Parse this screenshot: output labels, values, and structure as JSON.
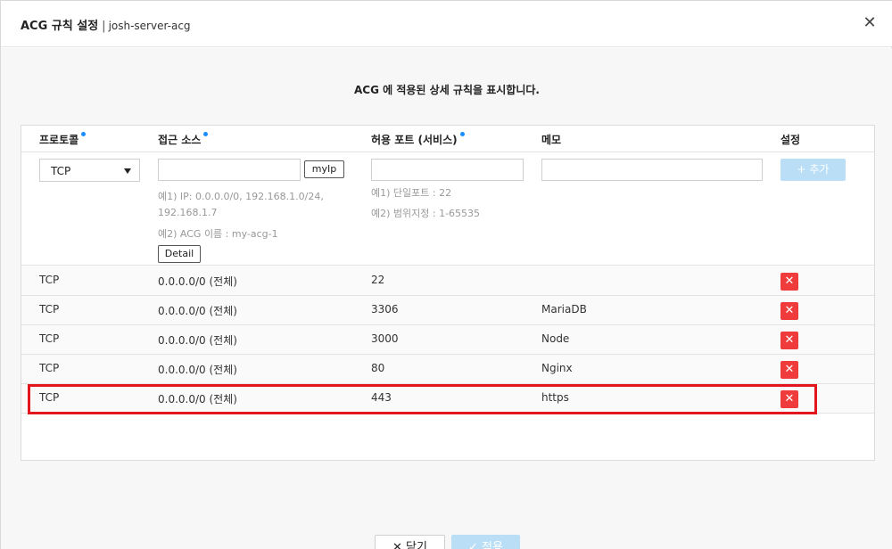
{
  "header": {
    "title_main": "ACG 규칙 설정",
    "separator": "|",
    "title_sub": "josh-server-acg",
    "close_glyph": "✕"
  },
  "description": "ACG 에 적용된 상세 규칙을 표시합니다.",
  "columns": {
    "protocol": "프로토콜",
    "source": "접근 소스",
    "port": "허용 포트 (서비스)",
    "memo": "메모",
    "settings": "설정"
  },
  "form": {
    "protocol_selected": "TCP",
    "myip_label": "myIp",
    "source_hint_1": "예1) IP: 0.0.0.0/0, 192.168.1.0/24,",
    "source_hint_1b": "192.168.1.7",
    "source_hint_2": "예2) ACG 이름 : my-acg-1",
    "detail_label": "Detail",
    "port_hint_1": "예1) 단일포트 : 22",
    "port_hint_2": "예2) 범위지정 : 1-65535",
    "add_label": "+ 추가"
  },
  "rules": [
    {
      "protocol": "TCP",
      "source": "0.0.0.0/0 (전체)",
      "port": "22",
      "memo": ""
    },
    {
      "protocol": "TCP",
      "source": "0.0.0.0/0 (전체)",
      "port": "3306",
      "memo": "MariaDB"
    },
    {
      "protocol": "TCP",
      "source": "0.0.0.0/0 (전체)",
      "port": "3000",
      "memo": "Node"
    },
    {
      "protocol": "TCP",
      "source": "0.0.0.0/0 (전체)",
      "port": "80",
      "memo": "Nginx"
    },
    {
      "protocol": "TCP",
      "source": "0.0.0.0/0 (전체)",
      "port": "443",
      "memo": "https"
    }
  ],
  "delete_glyph": "✕",
  "footer": {
    "close_label": "✕  닫기",
    "apply_label": "✓  적용"
  },
  "colors": {
    "required_dot": "#1a8cff",
    "delete_button": "#ef3b3b",
    "highlight_border": "#e3161d",
    "disabled_primary": "#b9def5"
  }
}
